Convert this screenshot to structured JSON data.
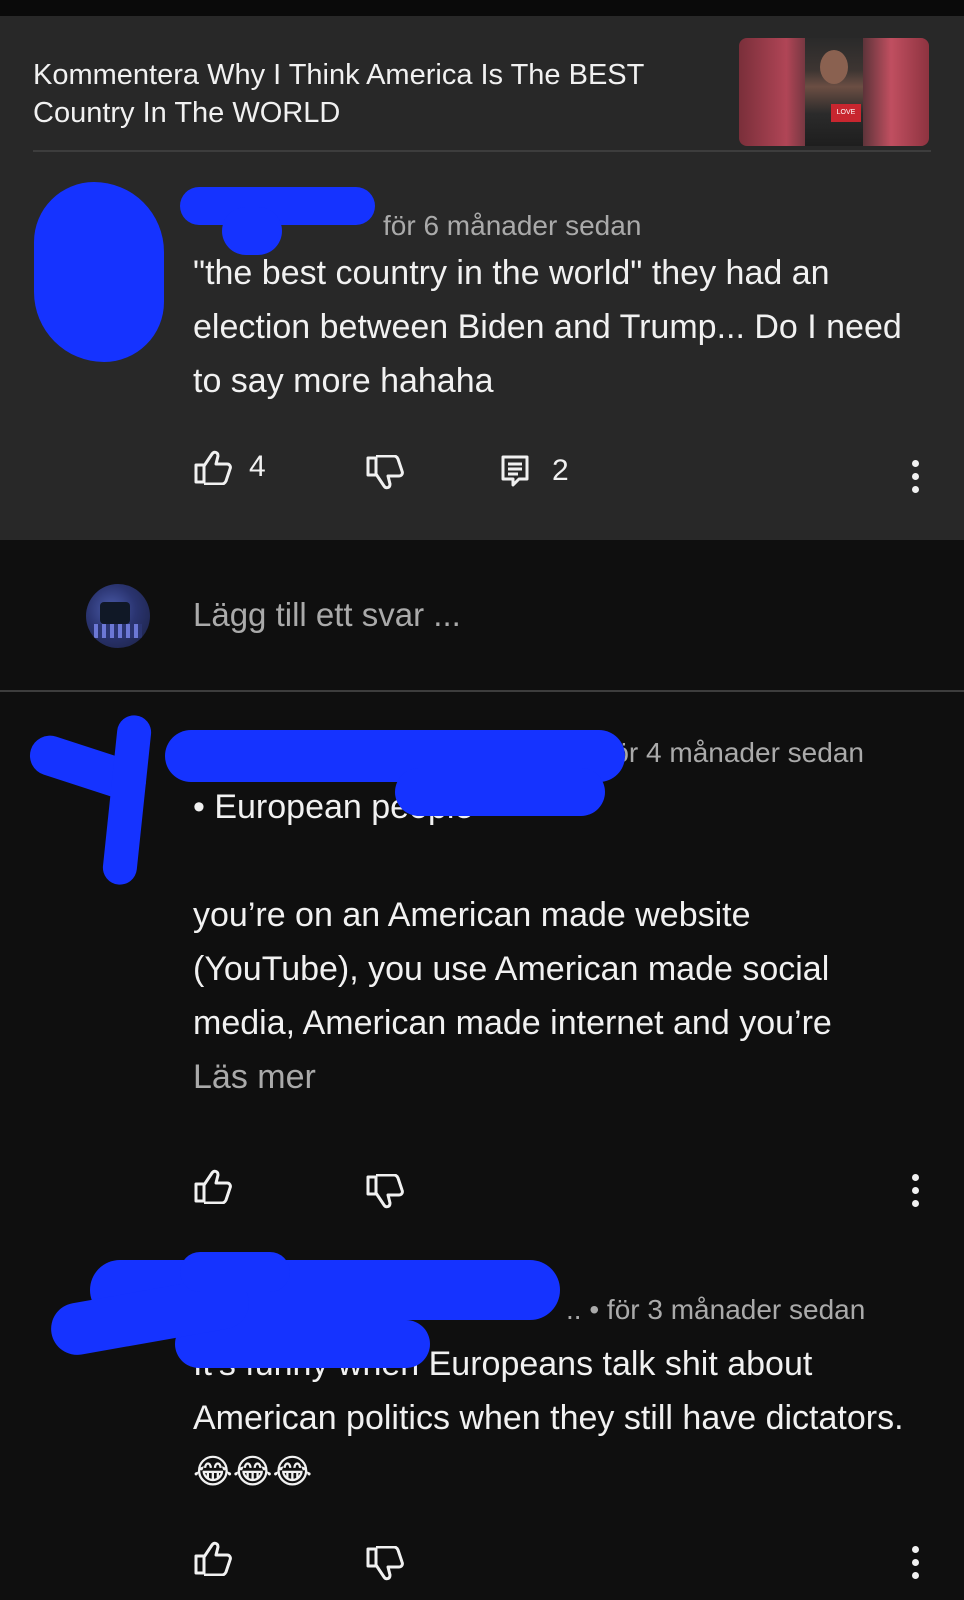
{
  "header": {
    "title": "Kommentera Why I Think America Is The BEST Country In The WORLD",
    "thumbnail_icon": "video-thumbnail",
    "thumbnail_tag": "LOVE"
  },
  "main_comment": {
    "time": "för 6 månader sedan",
    "text": "\"the best country in the world\" they had an election between Biden and Trump... Do I need to say more hahaha",
    "likes": "4",
    "replies": "2",
    "icons": [
      "thumbs-up-icon",
      "thumbs-down-icon",
      "reply-icon",
      "more-vert-icon"
    ]
  },
  "reply_input": {
    "placeholder": "Lägg till ett svar ..."
  },
  "reply1": {
    "time": "• för 4 månader sedan",
    "mention": "• European people",
    "text": "you’re on an American made website (YouTube), you use American made social media, American made internet and you’re",
    "read_more": "Läs mer"
  },
  "reply2": {
    "time": ".. • för 3 månader sedan",
    "text": "It’s funny when Europeans talk shit about American politics when they still have dictators.",
    "emoji": "😂😂😂"
  },
  "colors": {
    "background": "#0f0f0f",
    "card": "#282828",
    "text": "#f1f1f1",
    "muted": "#aaaaaa",
    "scribble": "#1533ff"
  }
}
